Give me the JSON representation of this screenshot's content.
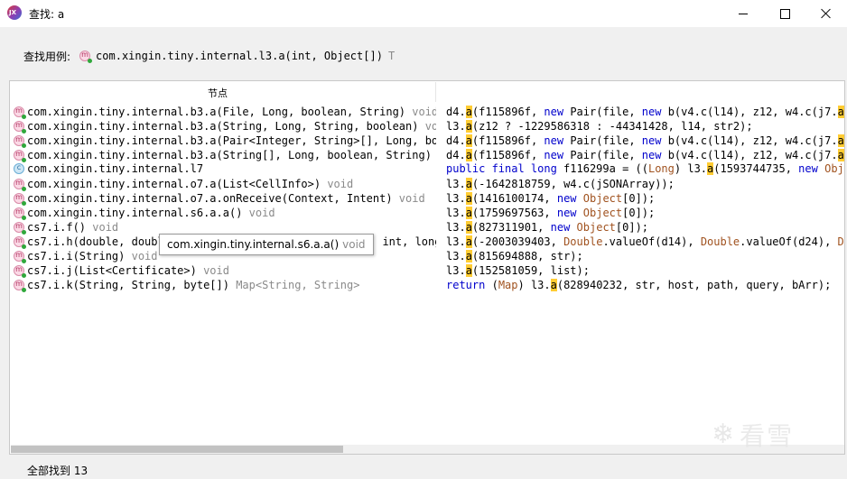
{
  "window": {
    "title": "查找: a"
  },
  "usage": {
    "label": "查找用例:",
    "method": "com.xingin.tiny.internal.l3.a(int, Object[])",
    "return_type": "T"
  },
  "table": {
    "column_header": "节点"
  },
  "results": [
    {
      "kind": "method",
      "sig": "com.xingin.tiny.internal.b3.a(File, Long, boolean, String)",
      "ret": "void"
    },
    {
      "kind": "method",
      "sig": "com.xingin.tiny.internal.b3.a(String, Long, String, boolean)",
      "ret": "vo"
    },
    {
      "kind": "method",
      "sig": "com.xingin.tiny.internal.b3.a(Pair<Integer, String>[], Long, bo",
      "ret": ""
    },
    {
      "kind": "method",
      "sig": "com.xingin.tiny.internal.b3.a(String[], Long, boolean, String)",
      "ret": ""
    },
    {
      "kind": "class",
      "sig": "com.xingin.tiny.internal.l7",
      "ret": ""
    },
    {
      "kind": "method",
      "sig": "com.xingin.tiny.internal.o7.a(List<CellInfo>)",
      "ret": "void"
    },
    {
      "kind": "method",
      "sig": "com.xingin.tiny.internal.o7.a.onReceive(Context, Intent)",
      "ret": "void"
    },
    {
      "kind": "method",
      "sig": "com.xingin.tiny.internal.s6.a.a()",
      "ret": "void"
    },
    {
      "kind": "method",
      "sig": "cs7.i.f()",
      "ret": "void"
    },
    {
      "kind": "method",
      "sig": "cs7.i.h(double, doubl",
      "ret": ""
    },
    {
      "kind": "method",
      "sig": "cs7.i.i(String)",
      "ret": "void"
    },
    {
      "kind": "method",
      "sig": "cs7.i.j(List<Certificate>)",
      "ret": "void"
    },
    {
      "kind": "method",
      "sig": "cs7.i.k(String, String, byte[])",
      "ret": "Map<String, String>"
    }
  ],
  "row9_tail": ", int, long",
  "tooltip": {
    "text": "com.xingin.tiny.internal.s6.a.a()",
    "ret": "void"
  },
  "code_lines": [
    [
      {
        "t": "d4."
      },
      {
        "t": "a",
        "c": "hl"
      },
      {
        "t": "(f115896f, "
      },
      {
        "t": "new",
        "c": "kw"
      },
      {
        "t": " Pair(file, "
      },
      {
        "t": "new",
        "c": "kw"
      },
      {
        "t": " b(v4.c(l14), z12, w4.c(j7."
      },
      {
        "t": "a",
        "c": "hl"
      },
      {
        "t": "((O"
      }
    ],
    [
      {
        "t": "l3."
      },
      {
        "t": "a",
        "c": "hl"
      },
      {
        "t": "(z12 ? -1229586318 : -44341428, l14, str2);"
      }
    ],
    [
      {
        "t": "d4."
      },
      {
        "t": "a",
        "c": "hl"
      },
      {
        "t": "(f115896f, "
      },
      {
        "t": "new",
        "c": "kw"
      },
      {
        "t": " Pair(file, "
      },
      {
        "t": "new",
        "c": "kw"
      },
      {
        "t": " b(v4.c(l14), z12, w4.c(j7."
      },
      {
        "t": "a",
        "c": "hl"
      },
      {
        "t": "((Ob"
      }
    ],
    [
      {
        "t": "d4."
      },
      {
        "t": "a",
        "c": "hl"
      },
      {
        "t": "(f115896f, "
      },
      {
        "t": "new",
        "c": "kw"
      },
      {
        "t": " Pair(file, "
      },
      {
        "t": "new",
        "c": "kw"
      },
      {
        "t": " b(v4.c(l14), z12, w4.c(j7."
      },
      {
        "t": "a",
        "c": "hl"
      },
      {
        "t": "((Ob"
      }
    ],
    [
      {
        "t": "public final long",
        "c": "kw"
      },
      {
        "t": " f116299a = (("
      },
      {
        "t": "Long",
        "c": "cls"
      },
      {
        "t": ") l3."
      },
      {
        "t": "a",
        "c": "hl"
      },
      {
        "t": "(1593744735, "
      },
      {
        "t": "new",
        "c": "kw"
      },
      {
        "t": " "
      },
      {
        "t": "Object",
        "c": "cls"
      },
      {
        "t": "["
      }
    ],
    [
      {
        "t": "l3."
      },
      {
        "t": "a",
        "c": "hl"
      },
      {
        "t": "(-1642818759, w4.c(jSONArray));"
      }
    ],
    [
      {
        "t": "l3."
      },
      {
        "t": "a",
        "c": "hl"
      },
      {
        "t": "(1416100174, "
      },
      {
        "t": "new",
        "c": "kw"
      },
      {
        "t": " "
      },
      {
        "t": "Object",
        "c": "cls"
      },
      {
        "t": "[0]);"
      }
    ],
    [
      {
        "t": "l3."
      },
      {
        "t": "a",
        "c": "hl"
      },
      {
        "t": "(1759697563, "
      },
      {
        "t": "new",
        "c": "kw"
      },
      {
        "t": " "
      },
      {
        "t": "Object",
        "c": "cls"
      },
      {
        "t": "[0]);"
      }
    ],
    [
      {
        "t": "l3."
      },
      {
        "t": "a",
        "c": "hl"
      },
      {
        "t": "(827311901, "
      },
      {
        "t": "new",
        "c": "kw"
      },
      {
        "t": " "
      },
      {
        "t": "Object",
        "c": "cls"
      },
      {
        "t": "[0]);"
      }
    ],
    [
      {
        "t": "l3."
      },
      {
        "t": "a",
        "c": "hl"
      },
      {
        "t": "(-2003039403, "
      },
      {
        "t": "Double",
        "c": "cls"
      },
      {
        "t": ".valueOf(d14), "
      },
      {
        "t": "Double",
        "c": "cls"
      },
      {
        "t": ".valueOf(d24), "
      },
      {
        "t": "Doubl",
        "c": "cls"
      }
    ],
    [
      {
        "t": "l3."
      },
      {
        "t": "a",
        "c": "hl"
      },
      {
        "t": "(815694888, str);"
      }
    ],
    [
      {
        "t": "l3."
      },
      {
        "t": "a",
        "c": "hl"
      },
      {
        "t": "(152581059, list);"
      }
    ],
    [
      {
        "t": "return",
        "c": "kw"
      },
      {
        "t": " ("
      },
      {
        "t": "Map",
        "c": "cls"
      },
      {
        "t": ") l3."
      },
      {
        "t": "a",
        "c": "hl"
      },
      {
        "t": "(828940232, str, host, path, query, bArr);"
      }
    ]
  ],
  "status": {
    "text": "全部找到 13"
  },
  "watermark": {
    "text": "看雪"
  },
  "icons": {
    "method": "m",
    "class": "c",
    "app": "JX"
  }
}
